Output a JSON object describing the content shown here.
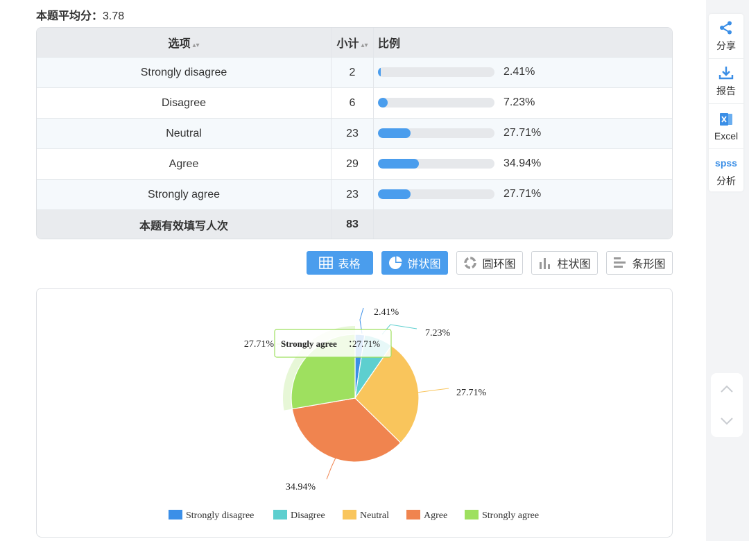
{
  "summary": {
    "avg_label": "本题平均分：",
    "avg_value": "3.78"
  },
  "table": {
    "headers": {
      "option": "选项",
      "count": "小计",
      "ratio": "比例"
    },
    "rows": [
      {
        "option": "Strongly disagree",
        "count": "2",
        "percent": "2.41%",
        "fraction": 0.0241
      },
      {
        "option": "Disagree",
        "count": "6",
        "percent": "7.23%",
        "fraction": 0.0723
      },
      {
        "option": "Neutral",
        "count": "23",
        "percent": "27.71%",
        "fraction": 0.2771
      },
      {
        "option": "Agree",
        "count": "29",
        "percent": "34.94%",
        "fraction": 0.3494
      },
      {
        "option": "Strongly agree",
        "count": "23",
        "percent": "27.71%",
        "fraction": 0.2771
      }
    ],
    "total_label": "本题有效填写人次",
    "total_value": "83"
  },
  "view_buttons": {
    "table": "表格",
    "pie": "饼状图",
    "donut": "圆环图",
    "column": "柱状图",
    "bar": "条形图"
  },
  "side_toolbar": {
    "share": "分享",
    "report": "报告",
    "excel": "Excel",
    "spss_logo": "spss",
    "analysis": "分析"
  },
  "chart_data": {
    "type": "pie",
    "categories": [
      "Strongly disagree",
      "Disagree",
      "Neutral",
      "Agree",
      "Strongly agree"
    ],
    "values": [
      2,
      6,
      23,
      29,
      23
    ],
    "labels": [
      "2.41%",
      "7.23%",
      "27.71%",
      "34.94%",
      "27.71%"
    ],
    "colors": [
      "#3b8fe8",
      "#5dcfcf",
      "#f9c55c",
      "#f0844f",
      "#9ee05f"
    ],
    "legend_position": "bottom",
    "tooltip": {
      "name": "Strongly agree",
      "value": "27.71%"
    },
    "highlighted": "Strongly agree"
  }
}
